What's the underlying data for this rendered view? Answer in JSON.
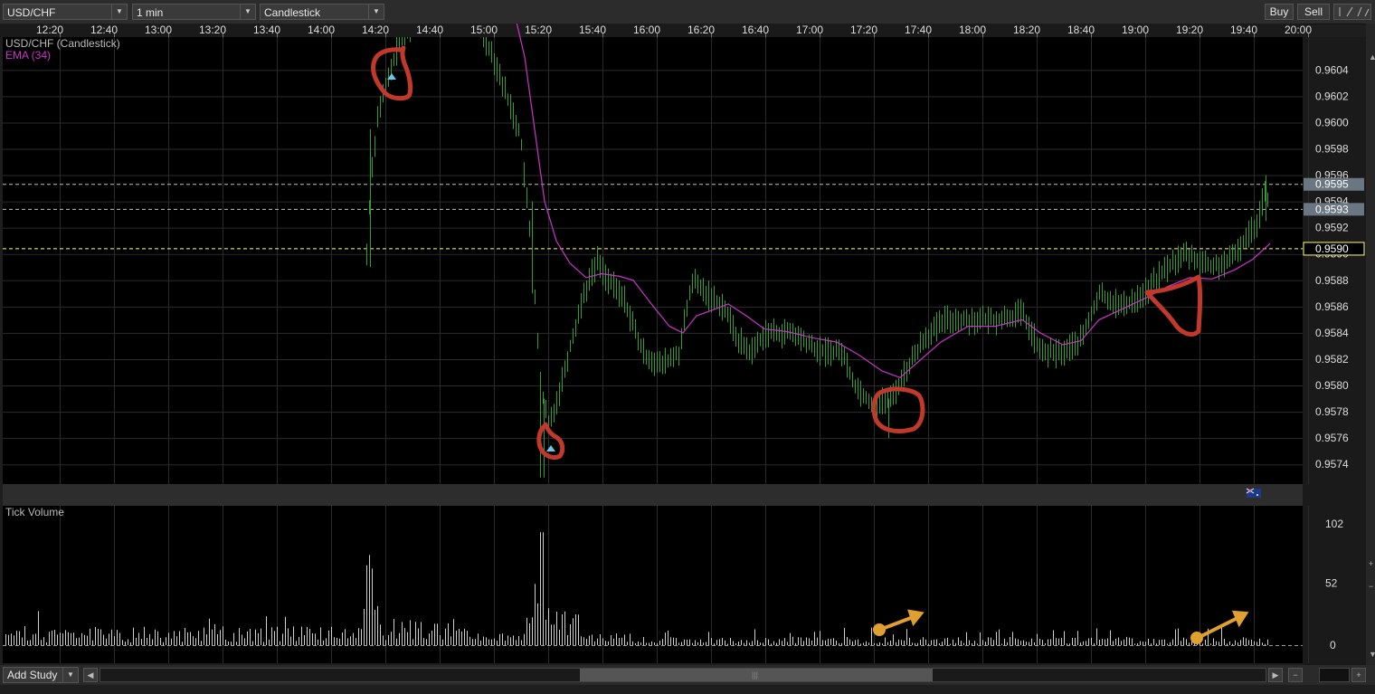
{
  "toolbar": {
    "symbol": "USD/CHF",
    "interval": "1 min",
    "chart_type": "Candlestick",
    "buy_label": "Buy",
    "sell_label": "Sell"
  },
  "time_axis": [
    "12:20",
    "12:40",
    "13:00",
    "13:20",
    "13:40",
    "14:00",
    "14:20",
    "14:40",
    "15:00",
    "15:20",
    "15:40",
    "16:00",
    "16:20",
    "16:40",
    "17:00",
    "17:20",
    "17:40",
    "18:00",
    "18:20",
    "18:40",
    "19:00",
    "19:20",
    "19:40",
    "20:00"
  ],
  "main_panel": {
    "title": "USD/CHF (Candlestick)",
    "study_label": "EMA (34)",
    "price_ticks": [
      "0.9604",
      "0.9602",
      "0.9600",
      "0.9598",
      "0.9596",
      "0.9594",
      "0.9592",
      "0.9590",
      "0.9588",
      "0.9586",
      "0.9584",
      "0.9582",
      "0.9580",
      "0.9578",
      "0.9576",
      "0.9574"
    ],
    "price_range": [
      0.95725,
      0.96065
    ],
    "price_lines": [
      {
        "label": "0.9595",
        "price": 0.95953,
        "color": "#bfbfbf"
      },
      {
        "label": "0.9593",
        "price": 0.95934,
        "color": "#bfbfbf"
      },
      {
        "label": "0.9590",
        "price": 0.95904,
        "color": "#ffff66"
      }
    ]
  },
  "volume_panel": {
    "title": "Tick Volume",
    "ticks": [
      "102",
      "52",
      "0"
    ]
  },
  "colors": {
    "background": "#000000",
    "grid": "#2b2b2b",
    "candle": "#2ea02e",
    "ema": "#cc33cc",
    "volume": "#d0d0d0",
    "annotation_red": "#c0392b",
    "annotation_orange": "#e0a030",
    "price_line": "#ffffff",
    "current_price": "#ffff66"
  },
  "footer": {
    "add_study_label": "Add Study"
  }
}
